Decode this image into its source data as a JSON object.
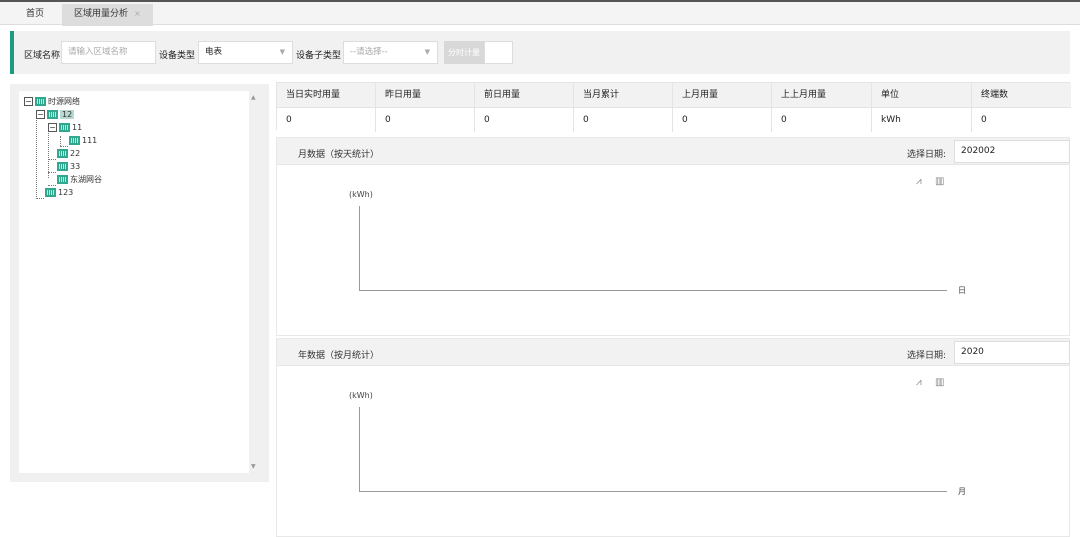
{
  "tabs": {
    "home": "首页",
    "active": "区域用量分析",
    "close": "×"
  },
  "filter": {
    "area_label": "区域名称",
    "area_placeholder": "请输入区域名称",
    "device_type_label": "设备类型",
    "device_type_value": "电表",
    "device_subtype_label": "设备子类型",
    "device_subtype_value": "--请选择--",
    "timed_button": "分时计量"
  },
  "tree": {
    "root": "时源网络",
    "nodes": [
      "12",
      "11",
      "111",
      "22",
      "33",
      "东湖网谷",
      "123"
    ]
  },
  "kpi": {
    "headers": [
      "当日实时用量",
      "昨日用量",
      "前日用量",
      "当月累计",
      "上月用量",
      "上上月用量",
      "单位",
      "终端数"
    ],
    "values": [
      "0",
      "0",
      "0",
      "0",
      "0",
      "0",
      "kWh",
      "0"
    ]
  },
  "monthly": {
    "title": "月数据（按天统计）",
    "date_label": "选择日期:",
    "date_value": "202002",
    "unit": "(kWh)",
    "x_unit": "日",
    "icons": [
      "line-chart-icon",
      "bar-chart-icon"
    ]
  },
  "yearly": {
    "title": "年数据（按月统计）",
    "date_label": "选择日期:",
    "date_value": "2020",
    "unit": "(kWh)",
    "x_unit": "月",
    "icons": [
      "line-chart-icon",
      "bar-chart-icon"
    ]
  },
  "colors": {
    "accent": "#1e9b7e",
    "building_icon": "#2fa88f",
    "selected_node": "#b8d9d1"
  }
}
